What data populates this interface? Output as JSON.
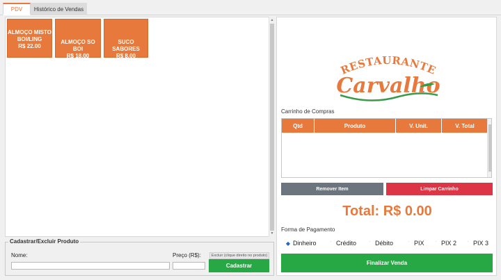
{
  "tabs": [
    {
      "label": "PDV",
      "active": true
    },
    {
      "label": "Histórico de Vendas",
      "active": false
    }
  ],
  "products": [
    {
      "name": "ALMOÇO MISTO BOI/LING",
      "price": "R$ 22.00"
    },
    {
      "name": "ALMOÇO SO BOI",
      "price": "R$ 18.00"
    },
    {
      "name": "SUCO SABORES",
      "price": "R$ 8.00"
    }
  ],
  "register": {
    "title": "Cadastrar/Excluir Produto",
    "name_label": "Nome:",
    "price_label": "Preço (R$):",
    "delete_hint": "Excluir (clique direito no produto)",
    "name_value": "",
    "price_value": "",
    "submit_label": "Cadastrar"
  },
  "logo": {
    "top_text": "RESTAURANTE",
    "script_text": "Carvalho"
  },
  "cart": {
    "label": "Carrinho de Compras",
    "columns": [
      "Qtd",
      "Produto",
      "V. Unit.",
      "V. Total"
    ],
    "remove_label": "Remover Item",
    "clear_label": "Limpar Carrinho"
  },
  "total": "Total: R$ 0.00",
  "payment": {
    "label": "Forma de Pagamento",
    "options": [
      "Dinheiro",
      "Crédito",
      "Débito",
      "PIX",
      "PIX 2",
      "PIX 3"
    ],
    "selected": "Dinheiro"
  },
  "finalize_label": "Finalizar Venda",
  "colors": {
    "accent": "#e8793c",
    "green": "#28a745",
    "red": "#dc3545",
    "gray": "#6c757d",
    "logo_green": "#3a9a4a"
  }
}
